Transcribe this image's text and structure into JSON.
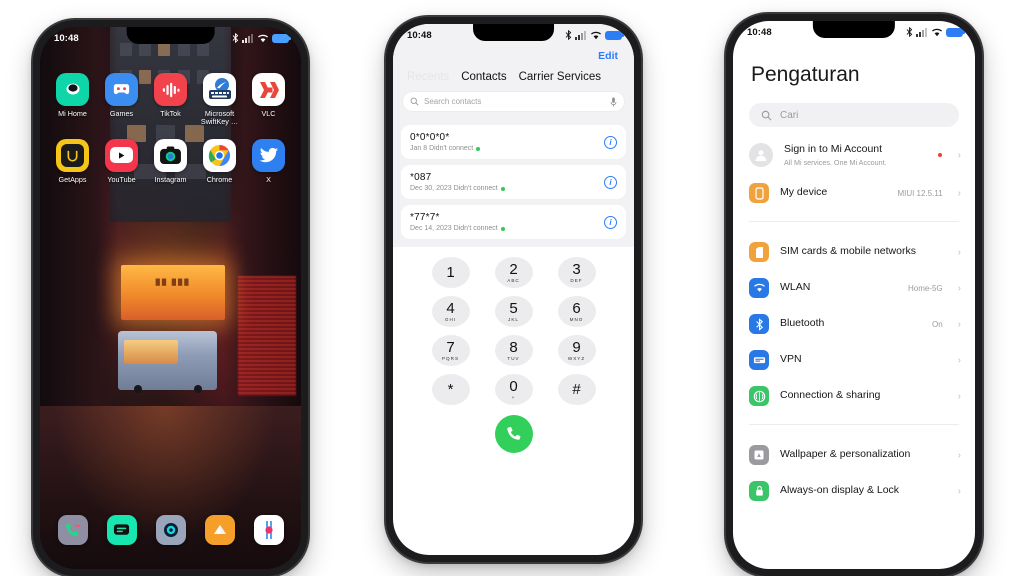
{
  "statusbar": {
    "time": "10:48",
    "icons": [
      "bluetooth-icon",
      "cellular-signal-icon",
      "wifi-icon",
      "battery-icon"
    ]
  },
  "phone1": {
    "name": "home-screen",
    "apps_row1": [
      {
        "label": "Mi Home",
        "icon": "mi-home-icon",
        "bg": "#0fd6a8"
      },
      {
        "label": "Games",
        "icon": "games-icon",
        "bg": "#3b8ef0"
      },
      {
        "label": "TikTok",
        "icon": "tiktok-icon",
        "bg": "#f2424b"
      },
      {
        "label": "Microsoft SwiftKey …",
        "icon": "microsoft-swiftkey-icon",
        "bg": "#ffffff"
      },
      {
        "label": "VLC",
        "icon": "vlc-icon",
        "bg": "#ffffff"
      }
    ],
    "apps_row2": [
      {
        "label": "GetApps",
        "icon": "getapps-icon",
        "bg": "#f5c518"
      },
      {
        "label": "YouTube",
        "icon": "youtube-icon",
        "bg": "#f4364c"
      },
      {
        "label": "Instagram",
        "icon": "instagram-icon",
        "bg": "#ffffff"
      },
      {
        "label": "Chrome",
        "icon": "chrome-icon",
        "bg": "#ffffff"
      },
      {
        "label": "X",
        "icon": "x-twitter-icon",
        "bg": "#2e7ff0"
      }
    ],
    "dock": [
      {
        "icon": "phone-dialer-icon",
        "bg": "#8e8fa3"
      },
      {
        "icon": "messages-icon",
        "bg": "#18e6b0"
      },
      {
        "icon": "browser-icon",
        "bg": "#9aa4bb"
      },
      {
        "icon": "file-manager-icon",
        "bg": "#f59f2a"
      },
      {
        "icon": "music-icon",
        "bg": "#ffffff"
      }
    ]
  },
  "phone2": {
    "name": "dialer-app",
    "edit_label": "Edit",
    "tabs": [
      {
        "label": "Recents",
        "state": "faded"
      },
      {
        "label": "Contacts",
        "state": "normal"
      },
      {
        "label": "Carrier Services",
        "state": "normal"
      }
    ],
    "search": {
      "placeholder": "Search contacts",
      "icon": "search-icon",
      "mic_icon": "microphone-icon"
    },
    "calls": [
      {
        "number": "0*0*0*0*",
        "detail": "Jan 8 Didn't connect",
        "info_icon": "info-icon"
      },
      {
        "number": "*087",
        "detail": "Dec 30, 2023 Didn't connect",
        "info_icon": "info-icon"
      },
      {
        "number": "*77*7*",
        "detail": "Dec 14, 2023 Didn't connect",
        "info_icon": "info-icon"
      }
    ],
    "keypad": [
      {
        "digit": "1",
        "letters": ""
      },
      {
        "digit": "2",
        "letters": "ABC"
      },
      {
        "digit": "3",
        "letters": "DEF"
      },
      {
        "digit": "4",
        "letters": "GHI"
      },
      {
        "digit": "5",
        "letters": "JKL"
      },
      {
        "digit": "6",
        "letters": "MNO"
      },
      {
        "digit": "7",
        "letters": "PQRS"
      },
      {
        "digit": "8",
        "letters": "TUV"
      },
      {
        "digit": "9",
        "letters": "WXYZ"
      },
      {
        "digit": "*",
        "letters": ""
      },
      {
        "digit": "0",
        "letters": "+"
      },
      {
        "digit": "#",
        "letters": ""
      }
    ],
    "call_button_icon": "phone-call-icon"
  },
  "phone3": {
    "name": "settings-app",
    "title": "Pengaturan",
    "search": {
      "placeholder": "Cari",
      "icon": "search-icon"
    },
    "group1": [
      {
        "label": "Sign in to Mi Account",
        "sub": "All Mi services. One Mi Account.",
        "value": "",
        "badge": true,
        "icon": "account-avatar-icon",
        "color": "#e3e3e6"
      },
      {
        "label": "My device",
        "sub": "",
        "value": "MIUI 12.5.11",
        "badge": false,
        "icon": "my-device-icon",
        "color": "#f0a33c"
      }
    ],
    "group2": [
      {
        "label": "SIM cards & mobile networks",
        "sub": "",
        "value": "",
        "icon": "sim-card-icon",
        "color": "#f0a33c"
      },
      {
        "label": "WLAN",
        "sub": "",
        "value": "Home-5G",
        "icon": "wifi-icon",
        "color": "#2878e6"
      },
      {
        "label": "Bluetooth",
        "sub": "",
        "value": "On",
        "icon": "bluetooth-icon",
        "color": "#2878e6"
      },
      {
        "label": "VPN",
        "sub": "",
        "value": "",
        "icon": "vpn-icon",
        "color": "#2878e6"
      },
      {
        "label": "Connection & sharing",
        "sub": "",
        "value": "",
        "icon": "connection-sharing-icon",
        "color": "#3ac569"
      }
    ],
    "group3": [
      {
        "label": "Wallpaper & personalization",
        "sub": "",
        "value": "",
        "icon": "wallpaper-icon",
        "color": "#9b9b9f"
      },
      {
        "label": "Always-on display & Lock",
        "sub": "",
        "value": "",
        "icon": "always-on-display-icon",
        "color": "#3ac569"
      }
    ],
    "chevron": "›"
  },
  "colors": {
    "accent_blue": "#2d7df6",
    "call_green": "#32cf5a",
    "badge_red": "#e8452c",
    "icon_orange": "#f0a33c",
    "icon_blue": "#2878e6",
    "icon_green": "#3ac569"
  }
}
